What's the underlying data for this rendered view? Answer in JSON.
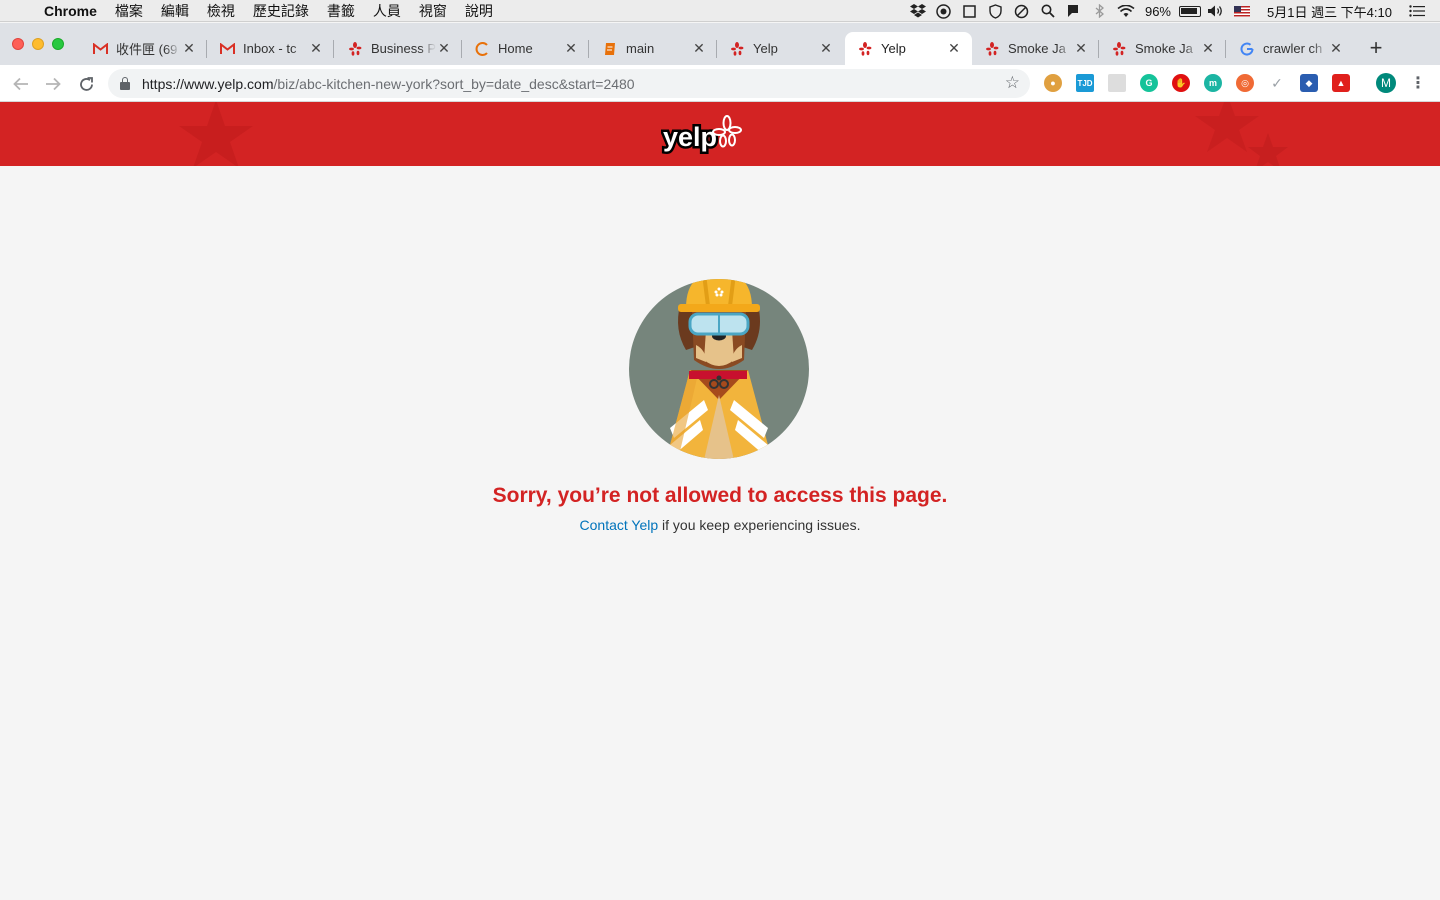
{
  "menubar": {
    "app": "Chrome",
    "items": [
      "檔案",
      "編輯",
      "檢視",
      "歷史記錄",
      "書籤",
      "人員",
      "視窗",
      "說明"
    ],
    "battery": "96%",
    "datetime": "5月1日 週三 下午4:10"
  },
  "tabs": [
    {
      "title": "收件匣 (69",
      "favicon": "gmail-icon",
      "color": "#d93025"
    },
    {
      "title": "Inbox - tc",
      "favicon": "gmail-icon",
      "color": "#d93025"
    },
    {
      "title": "Business P",
      "favicon": "yelp-icon",
      "color": "#d32323"
    },
    {
      "title": "Home",
      "favicon": "home-icon",
      "color": "#e8710a"
    },
    {
      "title": "main",
      "favicon": "doc-icon",
      "color": "#e8710a"
    },
    {
      "title": "Yelp",
      "favicon": "yelp-icon",
      "color": "#d32323"
    },
    {
      "title": "Yelp",
      "favicon": "yelp-icon",
      "color": "#d32323",
      "active": true
    },
    {
      "title": "Smoke Ja",
      "favicon": "yelp-icon",
      "color": "#d32323"
    },
    {
      "title": "Smoke Ja",
      "favicon": "yelp-icon",
      "color": "#d32323"
    },
    {
      "title": "crawler ch",
      "favicon": "google-icon",
      "color": "#4285f4"
    }
  ],
  "toolbar": {
    "url_host": "https://www.yelp.com",
    "url_path": "/biz/abc-kitchen-new-york?sort_by=date_desc&start=2480",
    "profile_initial": "M"
  },
  "page": {
    "logo_text": "yelp",
    "headline": "Sorry, you’re not allowed to access this page.",
    "contact_link": "Contact Yelp",
    "contact_rest": " if you keep experiencing issues."
  },
  "colors": {
    "brand_red": "#d32323",
    "link_blue": "#0073bb",
    "background": "#f5f5f5"
  }
}
